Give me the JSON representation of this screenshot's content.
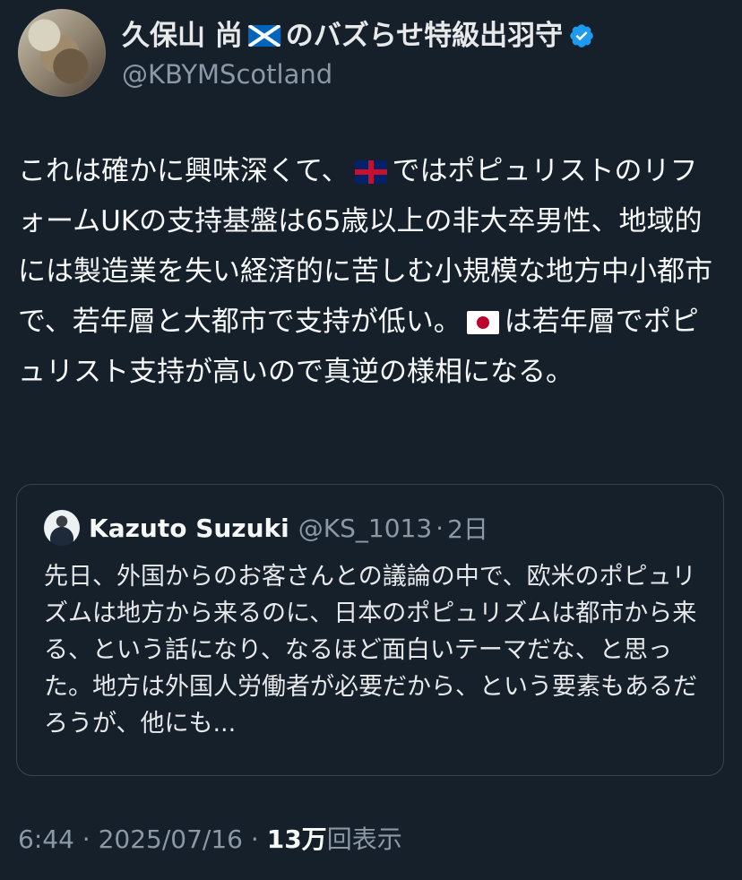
{
  "author": {
    "display_name_prefix": "久保山 尚",
    "display_name_suffix": "のバズらせ特級出羽守",
    "handle": "@KBYMScotland",
    "verified_icon": "verified-badge-icon"
  },
  "tweet": {
    "text_1": "これは確かに興味深くて、",
    "text_2": "ではポピュリストのリフォームUKの支持基盤は65歳以上の非大卒男性、地域的には製造業を失い経済的に苦しむ小規模な地方中小都市で、若年層と大都市で支持が低い。",
    "text_3": "は若年層でポピュリスト支持が高いので真逆の様相になる。"
  },
  "quoted_tweet": {
    "display_name": "Kazuto Suzuki",
    "handle": "@KS_1013",
    "separator": "·",
    "time": "2日",
    "text": "先日、外国からのお客さんとの議論の中で、欧米のポピュリズムは地方から来るのに、日本のポピュリズムは都市から来る、という話になり、なるほど面白いテーマだな、と思った。地方は外国人労働者が必要だから、という要素もあるだろうが、他にも..."
  },
  "meta": {
    "time": "6:44",
    "separator_1": "·",
    "date": "2025/07/16",
    "separator_2": "·",
    "views_count": "13万",
    "views_label": "回表示"
  },
  "icons": {
    "scotland_flag": "scotland-flag-icon",
    "uk_flag": "uk-flag-icon",
    "japan_flag": "japan-flag-icon"
  },
  "colors": {
    "background": "#15202b",
    "primary_text": "#e7e9ea",
    "secondary_text": "#8b98a5",
    "border": "#38444d",
    "verified": "#1d9bf0"
  }
}
